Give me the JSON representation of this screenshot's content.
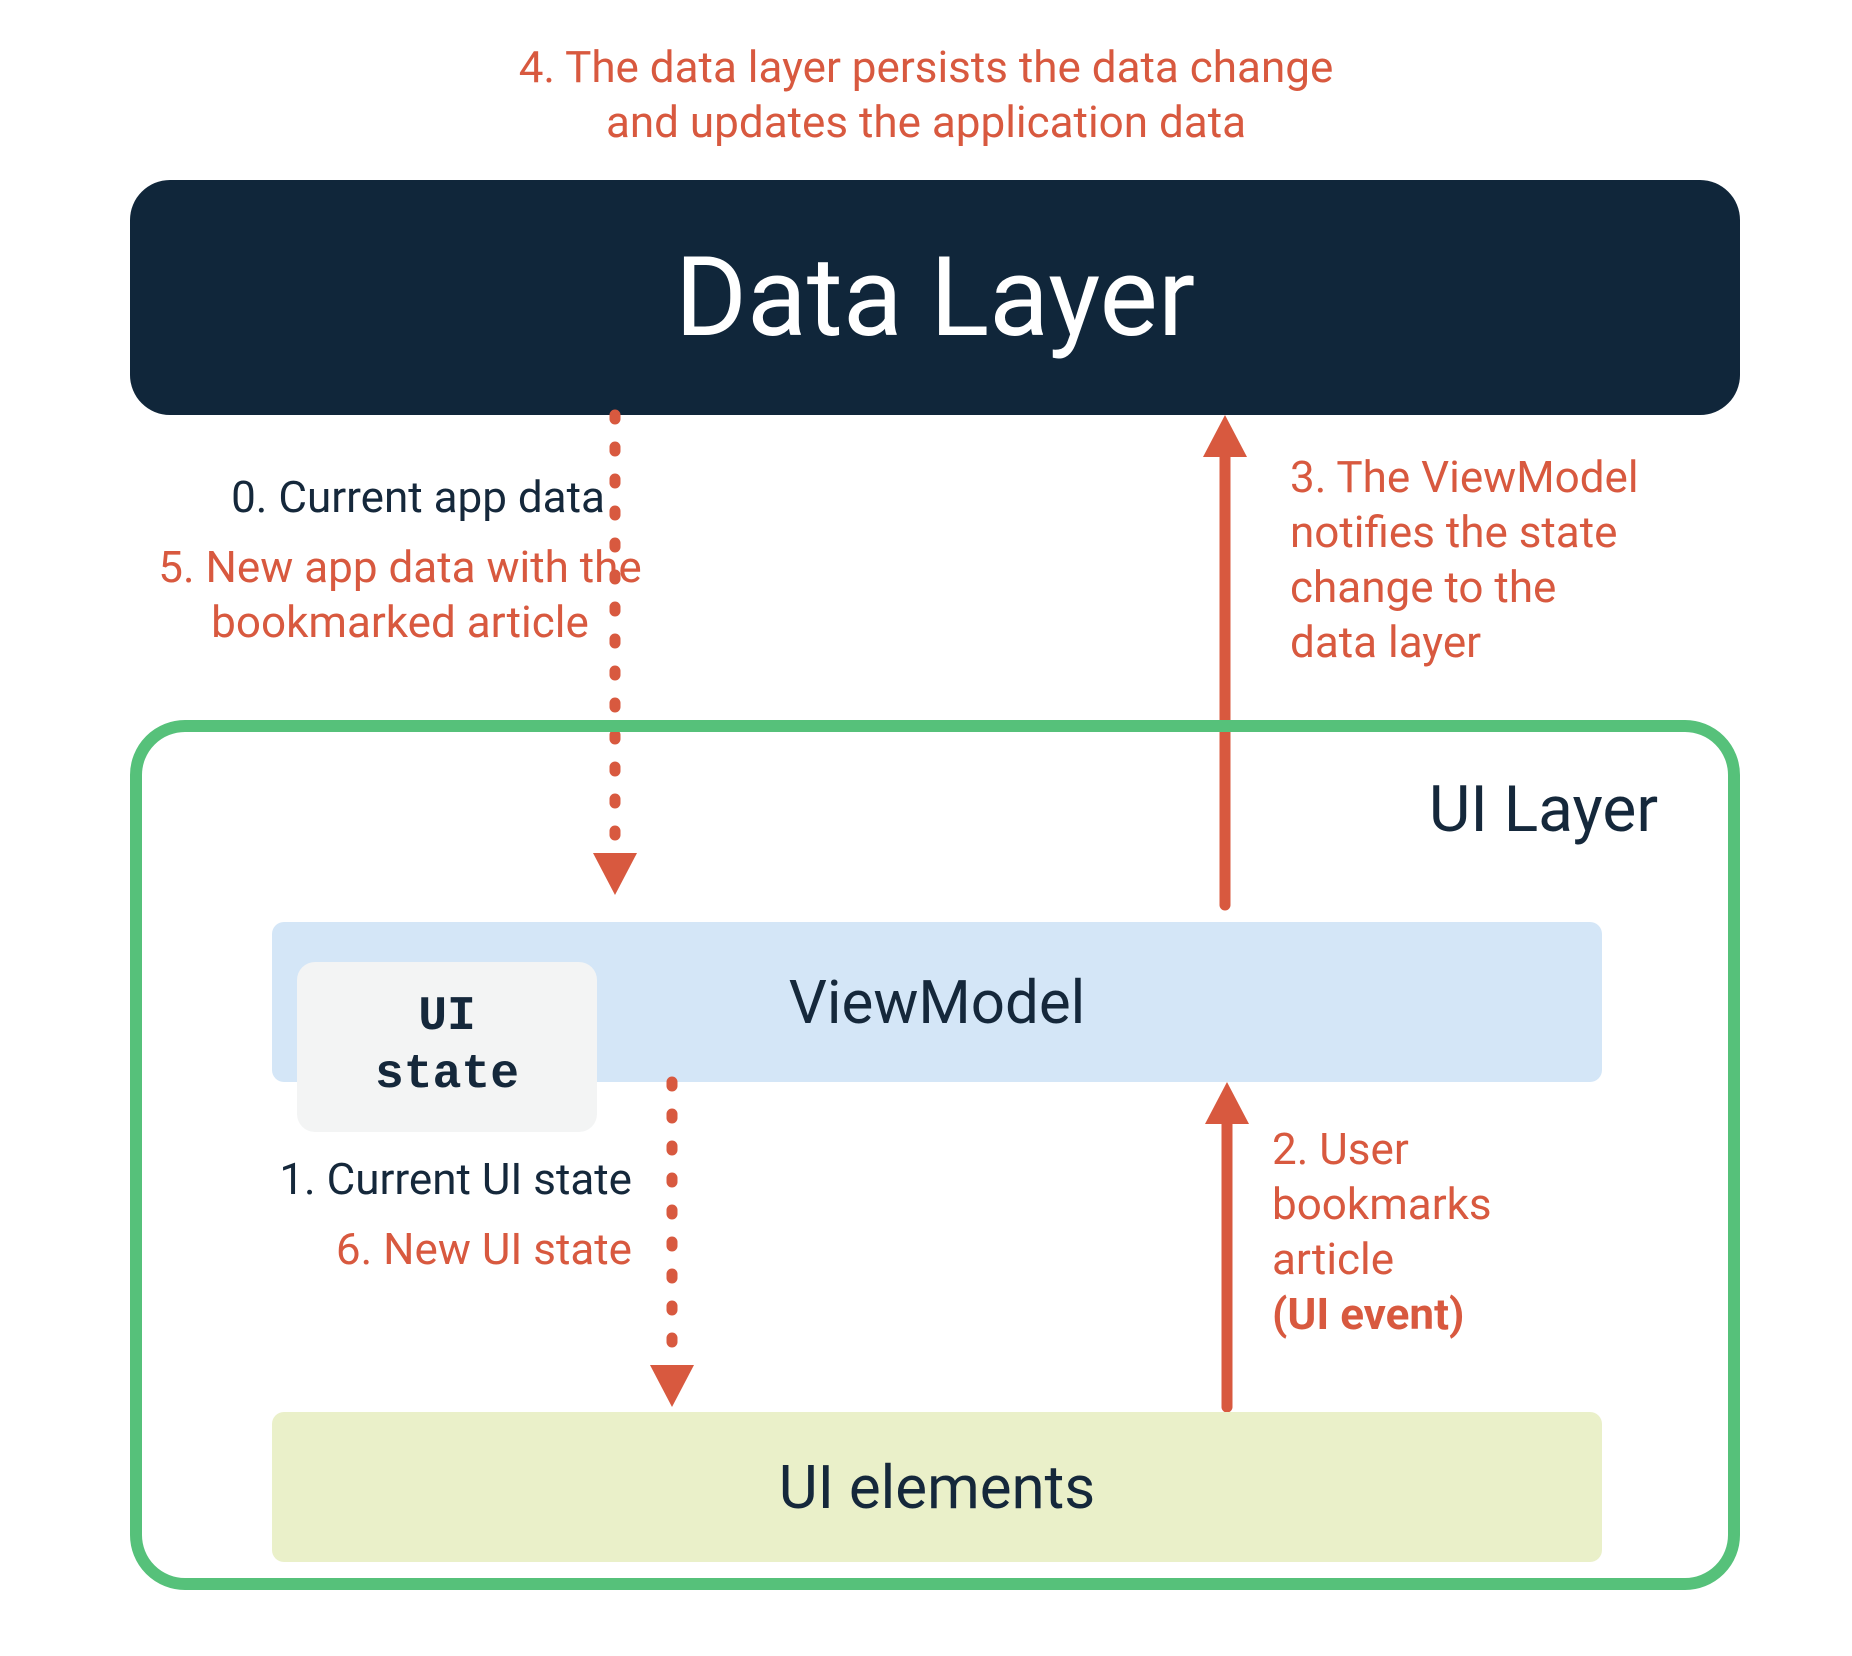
{
  "step4": "4. The data layer persists the data change\nand updates the application data",
  "data_layer": "Data Layer",
  "step0": "0. Current app data",
  "step5": "5. New app data with the\nbookmarked article",
  "step3": "3. The ViewModel\nnotifies the state\nchange to the\ndata layer",
  "ui_layer_label": "UI Layer",
  "viewmodel": "ViewModel",
  "ui_state": "UI\nstate",
  "step1": "1. Current UI state",
  "step6": "6. New UI state",
  "step2_line1": "2. User",
  "step2_line2": "bookmarks",
  "step2_line3": "article",
  "step2_line4": "(UI event)",
  "ui_elements": "UI elements",
  "colors": {
    "orange": "#d8593f",
    "dark": "#15283b",
    "green": "#56c17a",
    "blue": "#d4e6f7",
    "olive": "#eaf0c9"
  }
}
